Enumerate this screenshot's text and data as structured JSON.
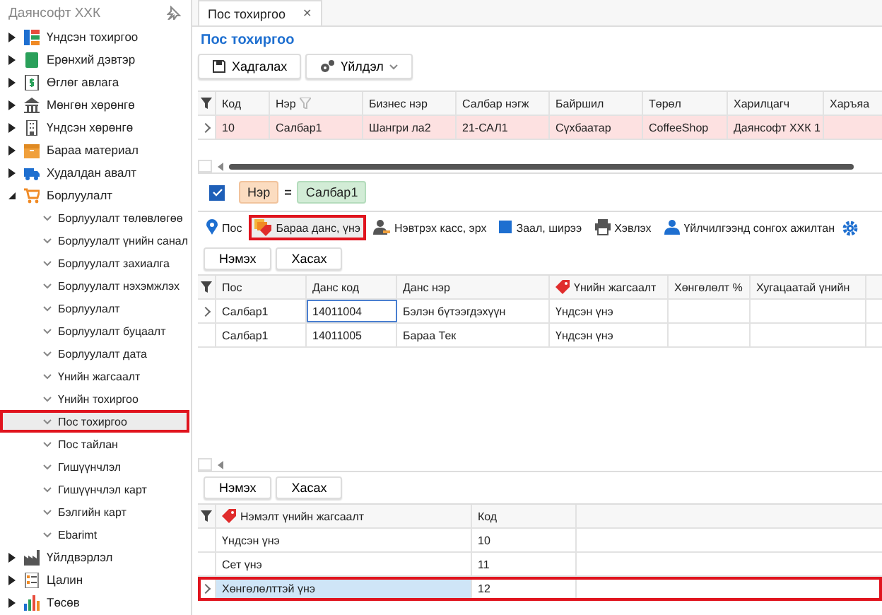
{
  "sidebar": {
    "title": "Даянсофт ХХК",
    "items": [
      {
        "label": "Үндсэн тохиргоо",
        "expanded": false
      },
      {
        "label": "Ерөнхий дэвтэр",
        "expanded": false
      },
      {
        "label": "Өглөг авлага",
        "expanded": false
      },
      {
        "label": "Мөнгөн хөрөнгө",
        "expanded": false
      },
      {
        "label": "Үндсэн хөрөнгө",
        "expanded": false
      },
      {
        "label": "Бараа материал",
        "expanded": false
      },
      {
        "label": "Худалдан авалт",
        "expanded": false
      },
      {
        "label": "Борлуулалт",
        "expanded": true,
        "children": [
          {
            "label": "Борлуулалт төлөвлөгөө",
            "selected": false,
            "marked": false
          },
          {
            "label": "Борлуулалт үнийн санал",
            "selected": false,
            "marked": false
          },
          {
            "label": "Борлуулалт захиалга",
            "selected": false,
            "marked": false
          },
          {
            "label": "Борлуулалт нэхэмжлэх",
            "selected": false,
            "marked": false
          },
          {
            "label": "Борлуулалт",
            "selected": false,
            "marked": false
          },
          {
            "label": "Борлуулалт буцаалт",
            "selected": false,
            "marked": false
          },
          {
            "label": "Борлуулалт дата",
            "selected": false,
            "marked": false
          },
          {
            "label": "Үнийн жагсаалт",
            "selected": false,
            "marked": false
          },
          {
            "label": "Үнийн тохиргоо",
            "selected": false,
            "marked": false
          },
          {
            "label": "Пос тохиргоо",
            "selected": true,
            "marked": true
          },
          {
            "label": "Пос тайлан",
            "selected": false,
            "marked": false
          },
          {
            "label": "Гишүүнчлэл",
            "selected": false,
            "marked": false
          },
          {
            "label": "Гишүүнчлэл карт",
            "selected": false,
            "marked": false
          },
          {
            "label": "Бэлгийн карт",
            "selected": false,
            "marked": false
          },
          {
            "label": "Ebarimt",
            "selected": false,
            "marked": false
          }
        ]
      },
      {
        "label": "Үйлдвэрлэл",
        "expanded": false
      },
      {
        "label": "Цалин",
        "expanded": false
      },
      {
        "label": "Төсөв",
        "expanded": false
      }
    ]
  },
  "document_tab": {
    "label": "Пос тохиргоо",
    "close": "✕"
  },
  "page_title": "Пос тохиргоо",
  "toolbar": [
    {
      "label": "Хадгалах",
      "kind": "save"
    },
    {
      "label": "Үйлдэл",
      "kind": "menu"
    }
  ],
  "pos_table": {
    "columns": [
      "Код",
      "Нэр",
      "Бизнес нэр",
      "Салбар нэгж",
      "Байршил",
      "Төрөл",
      "Харилцагч",
      "Харъяа"
    ],
    "rows": [
      {
        "selected": true,
        "cells": [
          "10",
          "Салбар1",
          "Шангри ла2",
          "21-САЛ1",
          "Сүхбаатар",
          "CoffeeShop",
          "Даянсофт ХХК 1",
          ""
        ]
      }
    ]
  },
  "filter": {
    "enabled": true,
    "field": "Нэр",
    "operator": "=",
    "value": "Салбар1"
  },
  "detail_tabs": [
    {
      "label": "Пос",
      "selected": false,
      "marked": false
    },
    {
      "label": "Бараа данс, үнэ",
      "selected": true,
      "marked": true
    },
    {
      "label": "Нэвтрэх касс, эрх",
      "selected": false,
      "marked": false
    },
    {
      "label": "Заал, ширээ",
      "selected": false,
      "marked": false
    },
    {
      "label": "Хэвлэх",
      "selected": false,
      "marked": false
    },
    {
      "label": "Үйлчилгээнд сонгох ажилтан",
      "selected": false,
      "marked": false
    }
  ],
  "account_buttons": [
    "Нэмэх",
    "Хасах"
  ],
  "account_table": {
    "columns": [
      "Пос",
      "Данс код",
      "Данс нэр",
      "Үнийн жагсаалт",
      "Хөнгөлөлт %",
      "Хугацаатай үнийн"
    ],
    "rows": [
      {
        "selected": true,
        "cells": [
          "Салбар1",
          "14011004",
          "Бэлэн бүтээгдэхүүн",
          "Үндсэн үнэ",
          "",
          ""
        ]
      },
      {
        "selected": false,
        "cells": [
          "Салбар1",
          "14011005",
          "Бараа Тек",
          "Үндсэн үнэ",
          "",
          ""
        ]
      }
    ]
  },
  "price_buttons": [
    "Нэмэх",
    "Хасах"
  ],
  "price_table": {
    "columns": [
      "Нэмэлт үнийн жагсаалт",
      "Код"
    ],
    "rows": [
      {
        "selected": false,
        "marked": false,
        "cells": [
          "Үндсэн үнэ",
          "10"
        ]
      },
      {
        "selected": false,
        "marked": false,
        "cells": [
          "Сет үнэ",
          "11"
        ]
      },
      {
        "selected": true,
        "marked": true,
        "cells": [
          "Хөнгөлөлттэй үнэ",
          "12"
        ]
      }
    ]
  }
}
